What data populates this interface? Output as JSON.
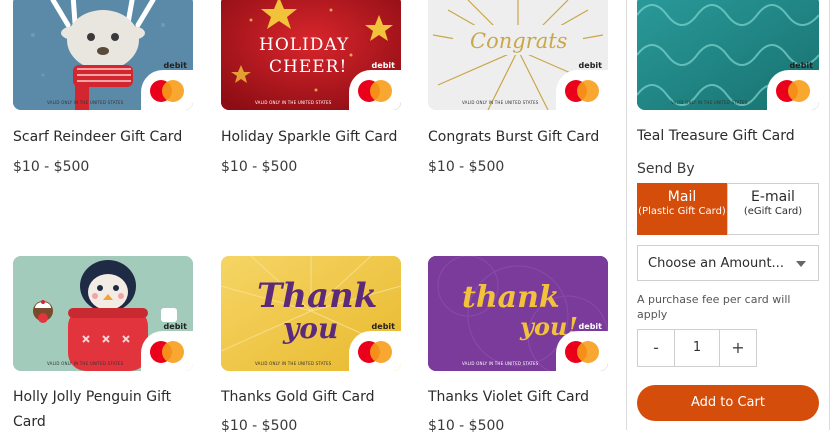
{
  "cards": [
    {
      "name": "Scarf Reindeer Gift Card",
      "price": "$10 - $500",
      "debit": "debit",
      "valid": "VALID ONLY IN THE UNITED STATES"
    },
    {
      "name": "Holiday Sparkle Gift Card",
      "price": "$10 - $500",
      "debit": "debit",
      "valid": "VALID ONLY IN THE UNITED STATES",
      "art_text_1": "HOLIDAY",
      "art_text_2": "CHEER!"
    },
    {
      "name": "Congrats Burst Gift Card",
      "price": "$10 - $500",
      "debit": "debit",
      "valid": "VALID ONLY IN THE UNITED STATES",
      "art_text_1": "Congrats"
    },
    {
      "name": "Holly Jolly Penguin Gift Card",
      "price": "$10 - $500",
      "debit": "debit",
      "valid": "VALID ONLY IN THE UNITED STATES"
    },
    {
      "name": "Thanks Gold Gift Card",
      "price": "$10 - $500",
      "debit": "debit",
      "valid": "VALID ONLY IN THE UNITED STATES",
      "art_text_1": "Thank",
      "art_text_2": "you"
    },
    {
      "name": "Thanks Violet Gift Card",
      "price": "$10 - $500",
      "debit": "debit",
      "valid": "VALID ONLY IN THE UNITED STATES",
      "art_text_1": "thank",
      "art_text_2": "you!"
    }
  ],
  "panel": {
    "title": "Teal Treasure Gift Card",
    "debit": "debit",
    "valid": "VALID ONLY IN THE UNITED STATES",
    "send_by_label": "Send By",
    "mail_label": "Mail",
    "mail_sub": "(Plastic Gift Card)",
    "email_label": "E-mail",
    "email_sub": "(eGift Card)",
    "amount_placeholder": "Choose an Amount...",
    "fee_note": "A purchase fee per card will apply",
    "minus": "-",
    "quantity": "1",
    "plus": "+",
    "add_to_cart": "Add to Cart"
  },
  "colors": {
    "accent": "#d44d0b",
    "mastercard_red": "#eb001b",
    "mastercard_orange": "#f79e1b"
  }
}
